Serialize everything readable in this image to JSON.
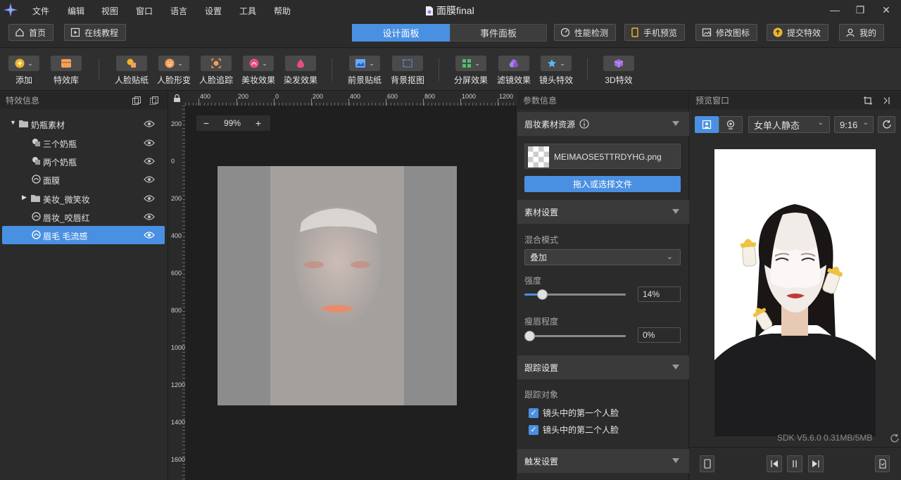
{
  "menubar": {
    "items": [
      "文件",
      "编辑",
      "视图",
      "窗口",
      "语言",
      "设置",
      "工具",
      "帮助"
    ],
    "title": "面膜final"
  },
  "nav": {
    "home": "首页",
    "tutorial": "在线教程",
    "tabs": [
      {
        "label": "设计面板",
        "active": true
      },
      {
        "label": "事件面板",
        "active": false
      }
    ],
    "perf": "性能检测",
    "mobile_preview": "手机预览",
    "modify_icon": "修改图标",
    "submit": "提交特效",
    "mine": "我的"
  },
  "toolbar": {
    "items": [
      "添加",
      "特效库",
      "人脸贴纸",
      "人脸形变",
      "人脸追踪",
      "美妆效果",
      "染发效果",
      "前景贴纸",
      "背景抠图",
      "分屏效果",
      "滤镜效果",
      "镜头特效",
      "3D特效"
    ]
  },
  "effects_panel": {
    "title": "特效信息",
    "tree": [
      {
        "label": "奶瓶素材",
        "level": 0,
        "kind": "folder",
        "expanded": true,
        "selected": false
      },
      {
        "label": "三个奶瓶",
        "level": 1,
        "kind": "sticker",
        "selected": false
      },
      {
        "label": "两个奶瓶",
        "level": 1,
        "kind": "sticker",
        "selected": false
      },
      {
        "label": "面膜",
        "level": 1,
        "kind": "makeup",
        "selected": false
      },
      {
        "label": "美妆_微笑妆",
        "level": 1,
        "kind": "folder",
        "expanded": false,
        "selected": false
      },
      {
        "label": "唇妆_咬唇红",
        "level": 1,
        "kind": "makeup",
        "selected": false
      },
      {
        "label": "眉毛 毛流感",
        "level": 1,
        "kind": "makeup",
        "selected": true
      }
    ]
  },
  "canvas": {
    "zoom": "99%",
    "hruler": [
      "400",
      "200",
      "0",
      "200",
      "400",
      "600",
      "800",
      "1000",
      "1200"
    ],
    "vruler": [
      "200",
      "0",
      "200",
      "400",
      "600",
      "800",
      "1000",
      "1200",
      "1400",
      "1600"
    ]
  },
  "params": {
    "title": "参数信息",
    "eyebrow_section": "眉妆素材资源",
    "file_name": "MEIMAOSE5TTRDYHG.png",
    "upload_button": "拖入或选择文件",
    "material_section": "素材设置",
    "blend_label": "混合模式",
    "blend_value": "叠加",
    "intensity_label": "强度",
    "intensity_value": "14%",
    "intensity_fraction": 0.14,
    "thin_label": "瘦眉程度",
    "thin_value": "0%",
    "thin_fraction": 0.0,
    "tracking_section": "跟踪设置",
    "tracking_target_label": "跟踪对象",
    "track_face1": "镜头中的第一个人脸",
    "track_face2": "镜头中的第二个人脸",
    "trigger_section": "触发设置"
  },
  "preview": {
    "title": "预览窗口",
    "mode": "女单人静态",
    "ratio": "9:16",
    "sdk": "SDK V5.6.0",
    "size": "0.31MB/5MB"
  },
  "colors": {
    "accent": "#4a90e2",
    "panel": "#2b2b2b",
    "canvas": "#1f1f1f"
  }
}
